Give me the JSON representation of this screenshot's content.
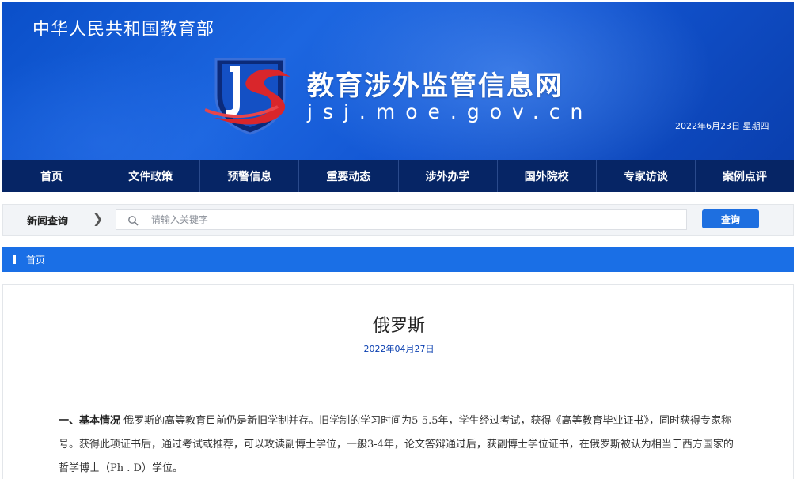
{
  "header": {
    "ministry": "中华人民共和国教育部",
    "site_title": "教育涉外监管信息网",
    "site_domain": "jsj.moe.gov.cn",
    "date": "2022年6月23日  星期四"
  },
  "nav": {
    "items": [
      "首页",
      "文件政策",
      "预警信息",
      "重要动态",
      "涉外办学",
      "国外院校",
      "专家访谈",
      "案例点评"
    ]
  },
  "search": {
    "label": "新闻查询",
    "placeholder": "请输入关键字",
    "button": "查询"
  },
  "breadcrumb": {
    "home": "首页"
  },
  "article": {
    "title": "俄罗斯",
    "date": "2022年04月27日",
    "lead": "一、基本情况",
    "body": "  俄罗斯的高等教育目前仍是新旧学制并存。旧学制的学习时间为5-5.5年，学生经过考试，获得《高等教育毕业证书》，同时获得专家称号。获得此项证书后，通过考试或推荐，可以攻读副博士学位，一般3-4年，论文答辩通过后，获副博士学位证书，在俄罗斯被认为相当于西方国家的哲学博士（Ph . D）学位。"
  },
  "colors": {
    "nav_bg": "#062565",
    "banner_blue": "#1255d2",
    "accent_blue": "#1a6fe6",
    "button_blue": "#1e6fe0",
    "logo_red": "#d9262b"
  },
  "icons": {
    "logo": "jsj-shield-logo-icon",
    "search": "search-icon",
    "chevron": "chevron-right-icon"
  }
}
